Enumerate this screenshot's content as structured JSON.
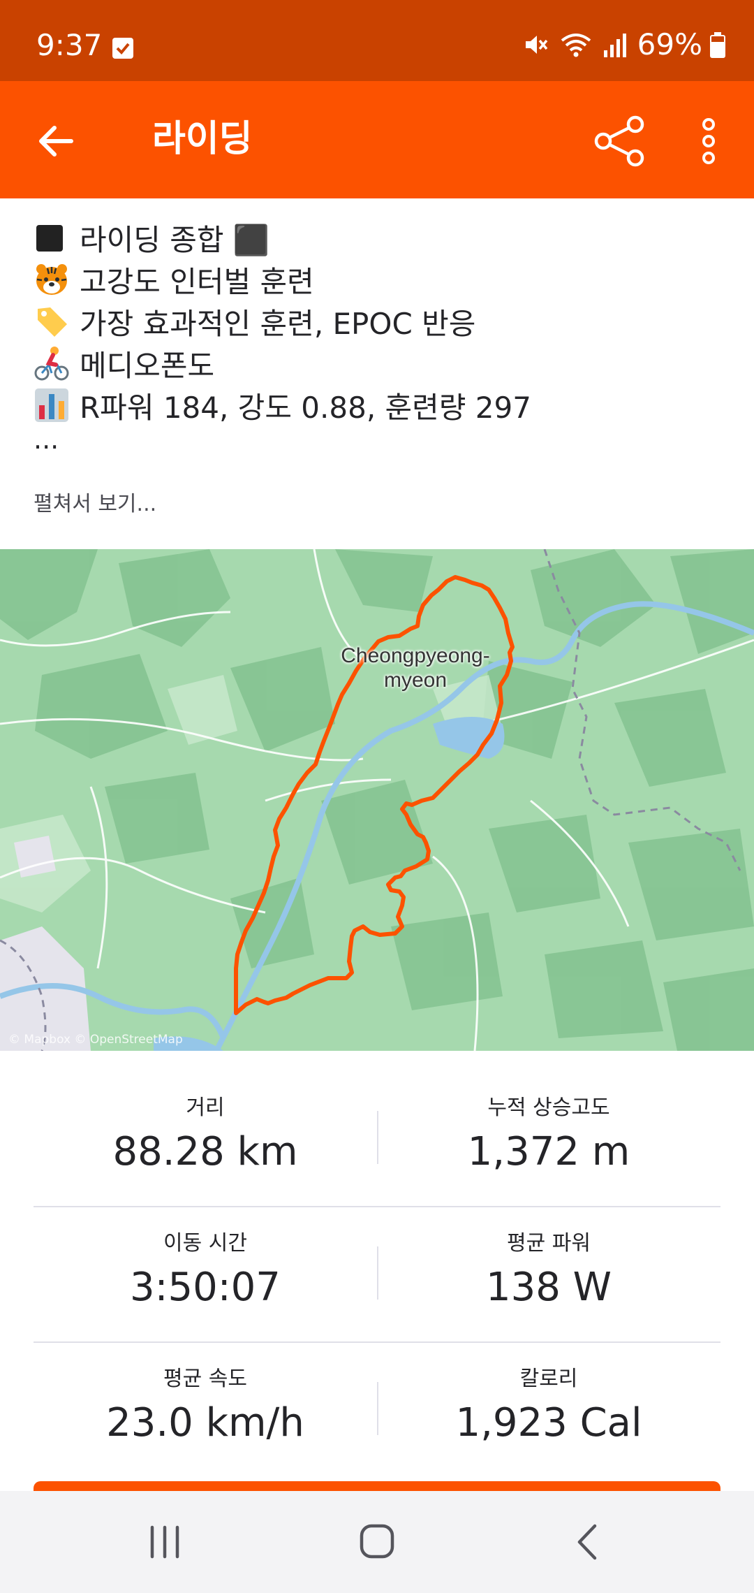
{
  "status_bar": {
    "time": "9:37",
    "battery": "69%"
  },
  "app_bar": {
    "title": "라이딩"
  },
  "description": {
    "lines": [
      {
        "emoji": "black-square-icon",
        "text": "라이딩 종합 ⬛"
      },
      {
        "emoji": "tiger-icon",
        "text": "고강도 인터벌 훈련"
      },
      {
        "emoji": "label-tag-icon",
        "text": "가장 효과적인 훈련, EPOC 반응"
      },
      {
        "emoji": "cyclist-icon",
        "text": "메디오폰도"
      },
      {
        "emoji": "bar-chart-icon",
        "text": "R파워 184, 강도 0.88, 훈련량 297"
      }
    ],
    "ellipsis": "...",
    "expand_label": "펼쳐서 보기..."
  },
  "map": {
    "place_label_1": "Cheongpyeong-",
    "place_label_2": "myeon",
    "attribution": "© Mapbox © OpenStreetMap",
    "route_color": "#FC5200"
  },
  "stats": {
    "distance": {
      "label": "거리",
      "value": "88.28 km"
    },
    "elevation": {
      "label": "누적 상승고도",
      "value": "1,372 m"
    },
    "moving_time": {
      "label": "이동 시간",
      "value": "3:50:07"
    },
    "avg_power": {
      "label": "평균 파워",
      "value": "138 W"
    },
    "avg_speed": {
      "label": "평균 속도",
      "value": "23.0 km/h"
    },
    "calories": {
      "label": "칼로리",
      "value": "1,923 Cal"
    }
  },
  "colors": {
    "brand": "#FC5200",
    "status_bar": "#C94200"
  }
}
